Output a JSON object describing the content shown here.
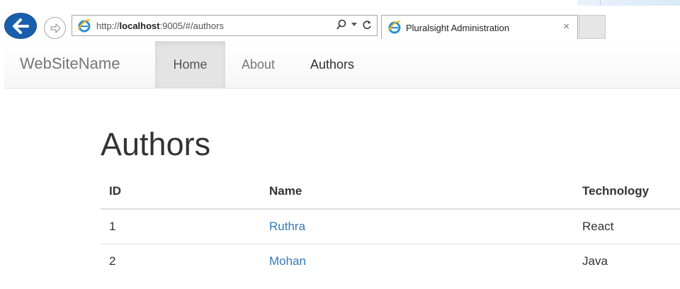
{
  "browser": {
    "address_prefix": "http://",
    "address_host": "localhost",
    "address_rest": ":9005/#/authors",
    "tab_title": "Pluralsight Administration",
    "tab_close": "×",
    "search_icon": "search-icon",
    "refresh_icon": "refresh-icon"
  },
  "navbar": {
    "brand": "WebSiteName",
    "items": [
      {
        "label": "Home",
        "active": true
      },
      {
        "label": "About",
        "active": false
      },
      {
        "label": "Authors",
        "active": false
      }
    ]
  },
  "main": {
    "title": "Authors",
    "table": {
      "headers": [
        "ID",
        "Name",
        "Technology"
      ],
      "rows": [
        {
          "id": "1",
          "name": "Ruthra",
          "technology": "React"
        },
        {
          "id": "2",
          "name": "Mohan",
          "technology": "Java"
        }
      ]
    }
  },
  "colors": {
    "back_button": "#1a5fae",
    "link": "#337ab7",
    "nav_active_bg": "#e4e4e4"
  }
}
